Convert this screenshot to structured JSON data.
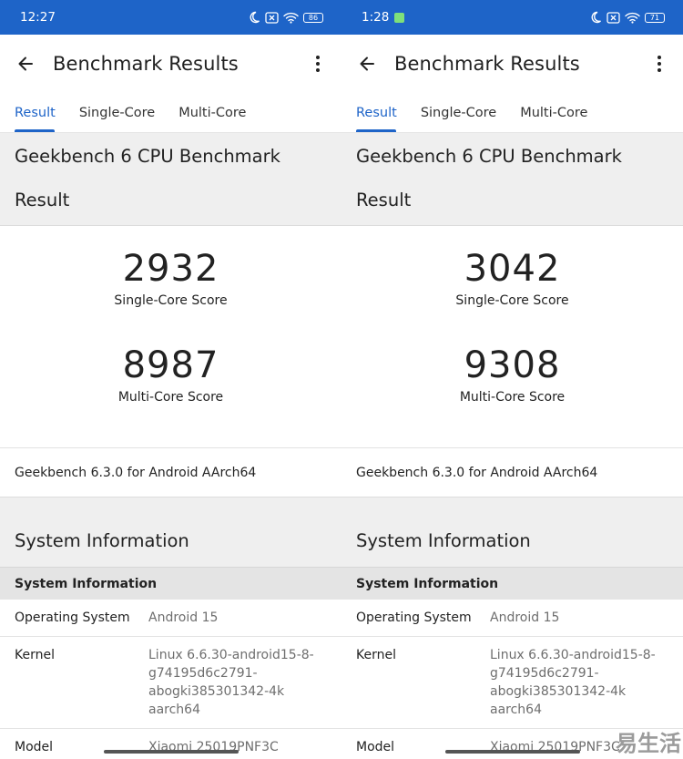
{
  "screens": [
    {
      "status": {
        "time": "12:27",
        "battery": "86"
      },
      "appbar": {
        "title": "Benchmark Results"
      },
      "tabs": [
        "Result",
        "Single-Core",
        "Multi-Core"
      ],
      "benchmark_title": "Geekbench 6 CPU Benchmark",
      "result_title": "Result",
      "single_score": "2932",
      "single_label": "Single-Core Score",
      "multi_score": "8987",
      "multi_label": "Multi-Core Score",
      "version": "Geekbench 6.3.0 for Android AArch64",
      "sysinfo_title": "System Information",
      "sysinfo_header": "System Information",
      "rows": [
        {
          "key": "Operating System",
          "value": "Android 15"
        },
        {
          "key": "Kernel",
          "value": "Linux 6.6.30-android15-8-g74195d6c2791-abogki385301342-4k aarch64"
        },
        {
          "key": "Model",
          "value": "Xiaomi 25019PNF3C"
        }
      ]
    },
    {
      "status": {
        "time": "1:28",
        "battery": "71"
      },
      "appbar": {
        "title": "Benchmark Results"
      },
      "tabs": [
        "Result",
        "Single-Core",
        "Multi-Core"
      ],
      "benchmark_title": "Geekbench 6 CPU Benchmark",
      "result_title": "Result",
      "single_score": "3042",
      "single_label": "Single-Core Score",
      "multi_score": "9308",
      "multi_label": "Multi-Core Score",
      "version": "Geekbench 6.3.0 for Android AArch64",
      "sysinfo_title": "System Information",
      "sysinfo_header": "System Information",
      "rows": [
        {
          "key": "Operating System",
          "value": "Android 15"
        },
        {
          "key": "Kernel",
          "value": "Linux 6.6.30-android15-8-g74195d6c2791-abogki385301342-4k aarch64"
        },
        {
          "key": "Model",
          "value": "Xiaomi 25019PNF3C"
        }
      ]
    }
  ],
  "watermark": "易生活",
  "colors": {
    "accent": "#1e64c8",
    "status_bar": "#1e64c8"
  },
  "icons": {
    "back": "arrow-left-icon",
    "more": "more-vert-icon",
    "moon": "moon-icon",
    "sim": "sim-off-icon",
    "wifi": "wifi-icon"
  }
}
